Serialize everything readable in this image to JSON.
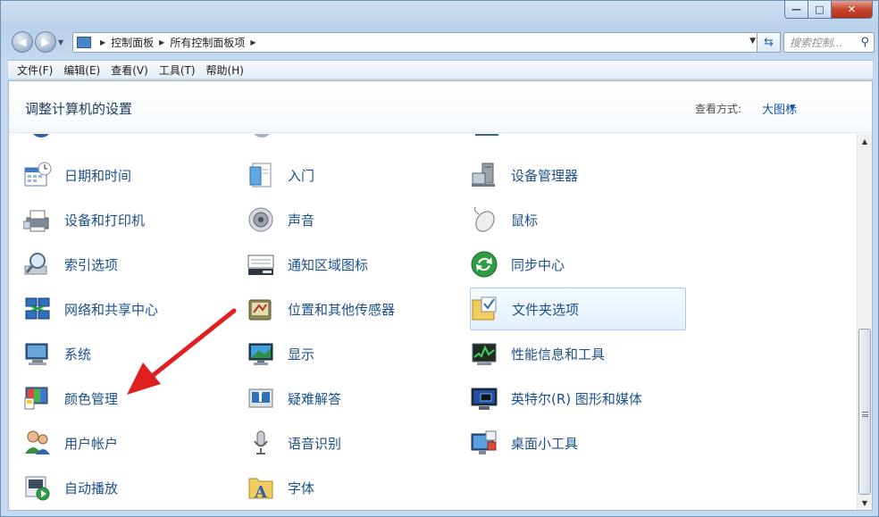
{
  "window": {
    "caption_buttons": {
      "minimize": "—",
      "maximize": "□",
      "close": "✕"
    }
  },
  "address_bar": {
    "crumbs": [
      "控制面板",
      "所有控制面板项"
    ],
    "search_placeholder": "搜索控制...",
    "icons": {
      "back": "arrow-left-icon",
      "forward": "arrow-right-icon",
      "refresh": "refresh-icon",
      "search": "magnifier-icon"
    }
  },
  "menubar": {
    "items": [
      "文件(F)",
      "编辑(E)",
      "查看(V)",
      "工具(T)",
      "帮助(H)"
    ]
  },
  "header": {
    "title": "调整计算机的设置",
    "view_label": "查看方式:",
    "view_value": "大图标"
  },
  "items": {
    "col1": [
      "日期和时间",
      "设备和打印机",
      "索引选项",
      "网络和共享中心",
      "系统",
      "颜色管理",
      "用户帐户",
      "自动播放"
    ],
    "col2": [
      "入门",
      "声音",
      "通知区域图标",
      "位置和其他传感器",
      "显示",
      "疑难解答",
      "语音识别",
      "字体"
    ],
    "col3": [
      "设备管理器",
      "鼠标",
      "同步中心",
      "文件夹选项",
      "性能信息和工具",
      "英特尔(R) 图形和媒体",
      "桌面小工具"
    ]
  },
  "colors": {
    "link": "#1c4f8e",
    "arrow": "#e02020",
    "hover_border": "#a9cbee"
  }
}
